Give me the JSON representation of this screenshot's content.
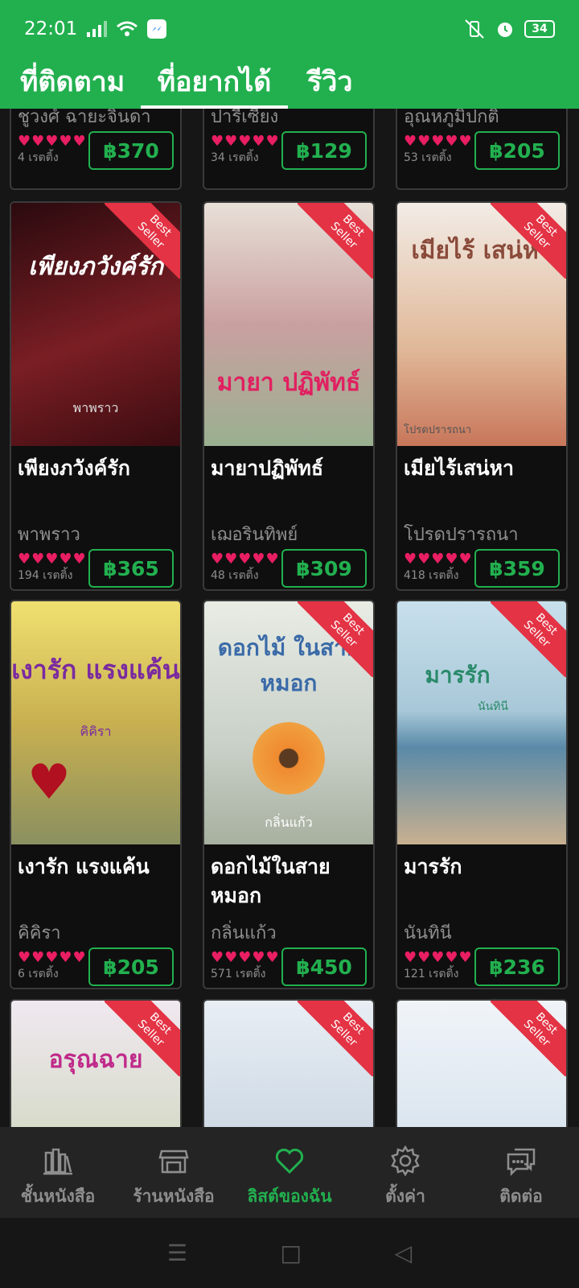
{
  "status_bar": {
    "time": "22:01",
    "battery": "34"
  },
  "tabs": [
    {
      "label": "ที่ติดตาม"
    },
    {
      "label": "ที่อยากได้",
      "active": true
    },
    {
      "label": "รีวิว"
    }
  ],
  "badge": {
    "line1": "Best",
    "line2": "Seller"
  },
  "books_partial": [
    {
      "author": "ชูวงศ์ ฉายะจินดา",
      "ratings": "4 เรตติ้ง",
      "price": "฿370"
    },
    {
      "author": "ปารีเซียง",
      "ratings": "34 เรตติ้ง",
      "price": "฿129"
    },
    {
      "author": "อุณหภูมิปกติ",
      "ratings": "53 เรตติ้ง",
      "price": "฿205"
    }
  ],
  "books": [
    {
      "title": "เพียงภวังค์รัก",
      "author": "พาพราว",
      "ratings": "194 เรตติ้ง",
      "price": "฿365",
      "cover_text": "เพียงภวังค์รัก",
      "cover_author": "พาพราว",
      "cover_color": "#7a1e24"
    },
    {
      "title": "มายาปฏิพัทธ์",
      "author": "เฌอรินทิพย์",
      "ratings": "48 เรตติ้ง",
      "price": "฿309",
      "cover_text": "มายา ปฏิพัทธ์",
      "cover_author": "",
      "cover_color": "#c9b7b0"
    },
    {
      "title": "เมียไร้เสน่หา",
      "author": "โปรดปรารถนา",
      "ratings": "418 เรตติ้ง",
      "price": "฿359",
      "cover_text": "เมียไร้ เสน่หา",
      "cover_author": "โปรดปรารถนา",
      "cover_color": "#e8d8cf"
    },
    {
      "title": "เงารัก แรงแค้น",
      "author": "คิคิรา",
      "ratings": "6 เรตติ้ง",
      "price": "฿205",
      "cover_text": "เงารัก แรงแค้น",
      "cover_author": "คิคิรา",
      "cover_color": "#d8c060"
    },
    {
      "title": "ดอกไม้ในสายหมอก",
      "author": "กลิ่นแก้ว",
      "ratings": "571 เรตติ้ง",
      "price": "฿450",
      "cover_text": "ดอกไม้ ในสายหมอก",
      "cover_author": "กลิ่นแก้ว",
      "cover_color": "#c8d0c8"
    },
    {
      "title": "มารรัก",
      "author": "นันทินี",
      "ratings": "121 เรตติ้ง",
      "price": "฿236",
      "cover_text": "มารรัก",
      "cover_author": "นันทินี",
      "cover_color": "#a8c8d8"
    }
  ],
  "books_bottom": [
    {
      "cover_text": "อรุณฉาย",
      "cover_color": "#c0d0a8"
    },
    {
      "cover_text": "",
      "cover_color": "#b8c8d8"
    },
    {
      "cover_text": "",
      "cover_color": "#c8d8e8"
    }
  ],
  "bottom_nav": [
    {
      "label": "ชั้นหนังสือ",
      "icon": "bookshelf-icon"
    },
    {
      "label": "ร้านหนังสือ",
      "icon": "store-icon"
    },
    {
      "label": "ลิสต์ของฉัน",
      "icon": "heart-icon",
      "active": true
    },
    {
      "label": "ตั้งค่า",
      "icon": "gear-icon"
    },
    {
      "label": "ติดต่อ",
      "icon": "chat-icon"
    }
  ],
  "colors": {
    "accent": "#22b04f",
    "heart": "#e91e63",
    "badge": "#e33344",
    "background": "#161616"
  }
}
